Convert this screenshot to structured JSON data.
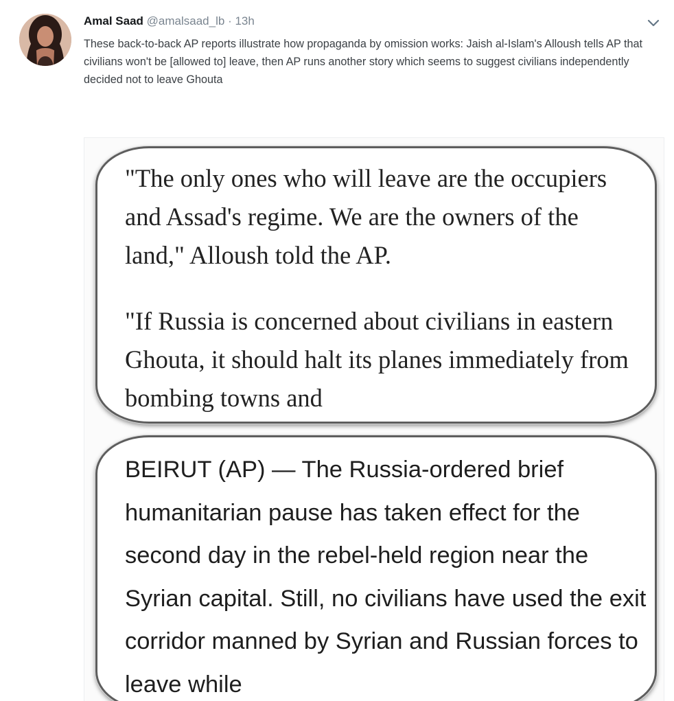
{
  "tweet": {
    "author_name": "Amal Saad",
    "handle": "@amalsaad_lb",
    "separator": "·",
    "time": "13h",
    "text": "These back-to-back AP reports illustrate how propaganda by omission works: Jaish al-Islam's Alloush tells AP that civilians won't be [allowed to] leave, then AP runs another story which seems to suggest civilians independently decided not to leave Ghouta",
    "menu_icon": "chevron-down-icon",
    "colors": {
      "name": "#14171a",
      "meta": "#7a8590",
      "text": "#3b4045"
    }
  },
  "media": {
    "quote_card": {
      "paragraph_1": "\"The only ones who will leave are the occupiers and Assad's regime. We are the owners of the land,\" Alloush told the AP.",
      "paragraph_2": "\"If Russia is concerned about civilians in eastern Ghouta, it should halt its planes immediately from bombing towns and"
    },
    "report_card": {
      "paragraph_1": "BEIRUT (AP) — The Russia-ordered brief humanitarian pause has taken effect for the second day in the rebel-held region near the Syrian capital. Still, no civilians have used the exit corridor manned by Syrian and Russian forces to leave while"
    }
  }
}
